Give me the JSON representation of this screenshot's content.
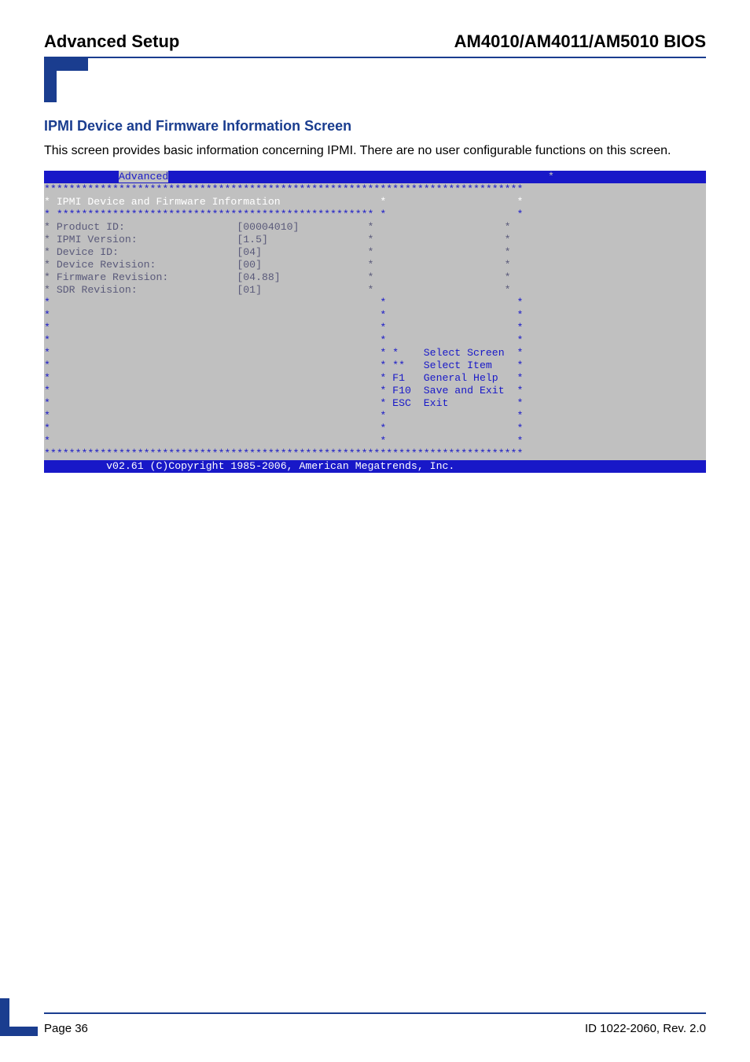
{
  "header": {
    "left": "Advanced Setup",
    "right": "AM4010/AM4011/AM5010 BIOS"
  },
  "section": {
    "title": "IPMI Device and Firmware Information Screen",
    "body": "This screen provides basic information concerning IPMI. There are no user configurable functions on this screen."
  },
  "bios": {
    "menubar_prefix": "            ",
    "menubar_selected": "Advanced",
    "menubar_suffix": "                                                             *",
    "border_top": "*****************************************************************************",
    "screen_title_row": "* IPMI Device and Firmware Information                *                     *",
    "sub_border": "* *************************************************** *                     *",
    "rows": [
      {
        "label": "* Product ID:                  ",
        "value": "[00004010]           ",
        "tail": "*                     *"
      },
      {
        "label": "* IPMI Version:                ",
        "value": "[1.5]                ",
        "tail": "*                     *"
      },
      {
        "label": "* Device ID:                   ",
        "value": "[04]                 ",
        "tail": "*                     *"
      },
      {
        "label": "* Device Revision:             ",
        "value": "[00]                 ",
        "tail": "*                     *"
      },
      {
        "label": "* Firmware Revision:           ",
        "value": "[04.88]              ",
        "tail": "*                     *"
      },
      {
        "label": "* SDR Revision:                ",
        "value": "[01]                 ",
        "tail": "*                     *"
      }
    ],
    "blank_rows_top": [
      "*                                                     *                     *",
      "*                                                     *                     *",
      "*                                                     *                     *",
      "*                                                     *                     *"
    ],
    "help_rows": [
      "*                                                     * *    Select Screen  *",
      "*                                                     * **   Select Item    *",
      "*                                                     * F1   General Help   *",
      "*                                                     * F10  Save and Exit  *",
      "*                                                     * ESC  Exit           *"
    ],
    "blank_rows_bottom": [
      "*                                                     *                     *",
      "*                                                     *                     *",
      "*                                                     *                     *"
    ],
    "border_bottom": "*****************************************************************************",
    "footer": "          v02.61 (C)Copyright 1985-2006, American Megatrends, Inc.           "
  },
  "footer": {
    "left": "Page 36",
    "right": "ID 1022-2060, Rev. 2.0"
  }
}
